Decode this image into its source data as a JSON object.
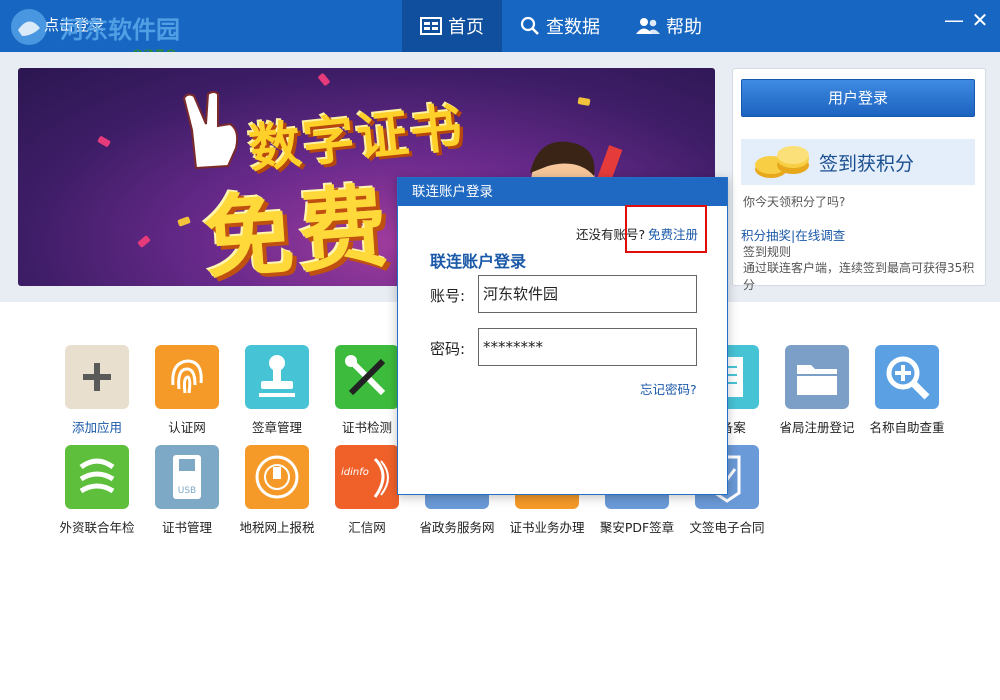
{
  "window": {
    "title": "点击登录",
    "watermark": {
      "name": "河东软件园",
      "url": "www.pc0359.cn"
    },
    "minimize": "—",
    "close": "✕"
  },
  "nav": {
    "tabs": [
      {
        "label": "首页",
        "icon": "home-icon"
      },
      {
        "label": "查数据",
        "icon": "search-icon"
      },
      {
        "label": "帮助",
        "icon": "users-icon"
      }
    ]
  },
  "banner": {
    "line1": "数字证书",
    "line2": "免费"
  },
  "login_panel": {
    "login_button": "用户登录",
    "checkin_title": "签到获积分",
    "question": "你今天领积分了吗?",
    "lottery_link": "积分抽奖",
    "separator": "|",
    "survey_link": "在线调查",
    "rules_link": "签到规则",
    "rules_desc": "通过联连客户端，连续签到最高可获得35积分"
  },
  "apps": [
    {
      "label": "添加应用",
      "icon": "plus-icon",
      "color": "#e8dfcf",
      "highlight": true
    },
    {
      "label": "认证网",
      "icon": "fingerprint-icon",
      "color": "#f59a28"
    },
    {
      "label": "签章管理",
      "icon": "stamp-icon",
      "color": "#47c3d6"
    },
    {
      "label": "证书检测",
      "icon": "tools-icon",
      "color": "#3dbb3c"
    },
    {
      "label": "上备案",
      "icon": "document-icon",
      "color": "#47c3d6"
    },
    {
      "label": "省局注册登记",
      "icon": "folder-icon",
      "color": "#7b9fc6"
    },
    {
      "label": "名称自助查重",
      "icon": "magnifier-icon",
      "color": "#5aa0e2"
    },
    {
      "label": "外资联合年检",
      "icon": "swirl-icon",
      "color": "#5dbf3b"
    },
    {
      "label": "证书管理",
      "icon": "usb-icon",
      "color": "#7ea9c6"
    },
    {
      "label": "地税网上报税",
      "icon": "tax-emblem-icon",
      "color": "#f59a28"
    },
    {
      "label": "汇信网",
      "icon": "idinfo-icon",
      "color": "#f0612a",
      "icon_text": "idinfo"
    },
    {
      "label": "省政务服务网",
      "icon": "gov-icon",
      "color": "#6b9ad8"
    },
    {
      "label": "证书业务办理",
      "icon": "business-icon",
      "color": "#f59a28"
    },
    {
      "label": "聚安PDF签章",
      "icon": "pdf-icon",
      "color": "#6b9ad8"
    },
    {
      "label": "文签电子合同",
      "icon": "contract-icon",
      "color": "#6b9ad8"
    }
  ],
  "dialog": {
    "title": "联连账户登录",
    "no_account": "还没有账号?",
    "register": "免费注册",
    "form_title": "联连账户登录",
    "account_label": "账号:",
    "account_value": "河东软件园",
    "password_label": "密码:",
    "password_value": "********",
    "forgot": "忘记密码?"
  }
}
